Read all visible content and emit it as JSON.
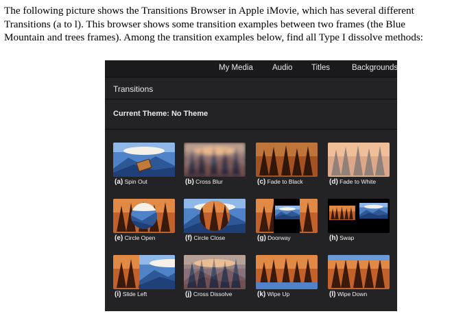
{
  "question": {
    "lines": [
      "The following picture shows the Transitions Browser in Apple iMovie, which has several different",
      "Transitions (a to l).  This browser shows some transition examples between two frames (the Blue",
      "Mountain and trees frames). Among the transition examples below, find all Type I dissolve methods:"
    ]
  },
  "app": {
    "nav": [
      "My Media",
      "Audio",
      "Titles",
      "Backgrounds"
    ],
    "section_title": "Transitions",
    "theme_label": "Current Theme: No Theme"
  },
  "transitions": [
    {
      "letter": "(a)",
      "name": "Spin Out",
      "icon": "spin-out-thumbnail"
    },
    {
      "letter": "(b)",
      "name": "Cross Blur",
      "icon": "cross-blur-thumbnail"
    },
    {
      "letter": "(c)",
      "name": "Fade to Black",
      "icon": "fade-to-black-thumbnail"
    },
    {
      "letter": "(d)",
      "name": "Fade to White",
      "icon": "fade-to-white-thumbnail"
    },
    {
      "letter": "(e)",
      "name": "Circle Open",
      "icon": "circle-open-thumbnail"
    },
    {
      "letter": "(f)",
      "name": "Circle Close",
      "icon": "circle-close-thumbnail"
    },
    {
      "letter": "(g)",
      "name": "Doorway",
      "icon": "doorway-thumbnail"
    },
    {
      "letter": "(h)",
      "name": "Swap",
      "icon": "swap-thumbnail"
    },
    {
      "letter": "(i)",
      "name": "Slide Left",
      "icon": "slide-left-thumbnail"
    },
    {
      "letter": "(j)",
      "name": "Cross Dissolve",
      "icon": "cross-dissolve-thumbnail"
    },
    {
      "letter": "(k)",
      "name": "Wipe Up",
      "icon": "wipe-up-thumbnail"
    },
    {
      "letter": "(l)",
      "name": "Wipe Down",
      "icon": "wipe-down-thumbnail"
    }
  ],
  "colors": {
    "panel_bg": "#232325",
    "sky_blue": "#5a8fd0",
    "forest_orange": "#c2612a"
  }
}
